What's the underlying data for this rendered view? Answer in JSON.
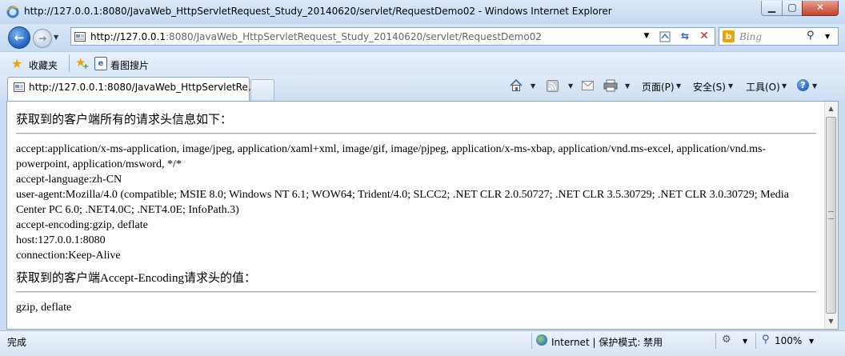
{
  "window": {
    "title": "http://127.0.0.1:8080/JavaWeb_HttpServletRequest_Study_20140620/servlet/RequestDemo02 - Windows Internet Explorer"
  },
  "address_bar": {
    "host": "http://127.0.0.1",
    "path": ":8080/JavaWeb_HttpServletRequest_Study_20140620/servlet/RequestDemo02"
  },
  "search": {
    "placeholder": "Bing"
  },
  "favorites_bar": {
    "favorites_label": "收藏夹",
    "suggested_sites_label": "看图搜片"
  },
  "tab": {
    "label": "http://127.0.0.1:8080/JavaWeb_HttpServletRe..."
  },
  "command_bar": {
    "page_menu": "页面(P)",
    "safety_menu": "安全(S)",
    "tools_menu": "工具(O)"
  },
  "page": {
    "heading_all_headers": "获取到的客户端所有的请求头信息如下：",
    "headers": [
      "accept:application/x-ms-application, image/jpeg, application/xaml+xml, image/gif, image/pjpeg, application/x-ms-xbap, application/vnd.ms-excel, application/vnd.ms-powerpoint, application/msword, */*",
      "accept-language:zh-CN",
      "user-agent:Mozilla/4.0 (compatible; MSIE 8.0; Windows NT 6.1; WOW64; Trident/4.0; SLCC2; .NET CLR 2.0.50727; .NET CLR 3.5.30729; .NET CLR 3.0.30729; Media Center PC 6.0; .NET4.0C; .NET4.0E; InfoPath.3)",
      "accept-encoding:gzip, deflate",
      "host:127.0.0.1:8080",
      "connection:Keep-Alive"
    ],
    "heading_accept_encoding": "获取到的客户端Accept-Encoding请求头的值：",
    "accept_encoding_value": "gzip, deflate"
  },
  "status_bar": {
    "status": "完成",
    "zone": "Internet | 保护模式: 禁用",
    "zoom": "100%"
  },
  "icons": {
    "back": "back-arrow-icon",
    "forward": "forward-arrow-icon",
    "refresh": "refresh-icon",
    "stop": "stop-icon",
    "search": "magnifier-icon",
    "home": "home-icon",
    "feeds": "rss-icon",
    "mail": "mail-icon",
    "print": "printer-icon",
    "help": "help-icon"
  },
  "colors": {
    "chrome": "#c9dcf2",
    "close_button": "#c4432b",
    "bing": "#f0a30a"
  }
}
